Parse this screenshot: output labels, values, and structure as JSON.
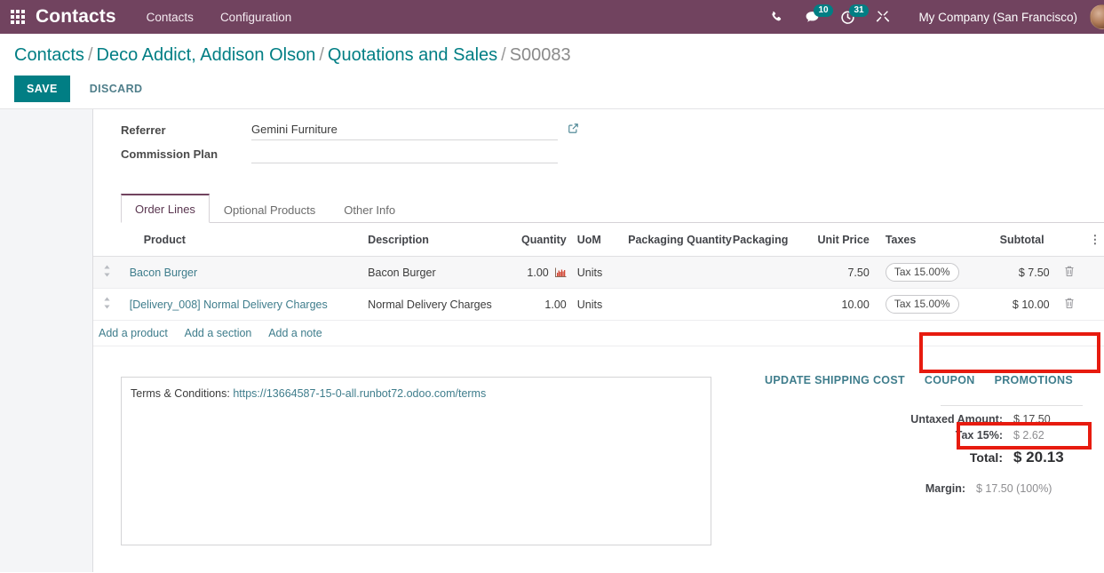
{
  "navbar": {
    "apps_icon": "apps-grid-icon",
    "brand": "Contacts",
    "menu": [
      {
        "label": "Contacts"
      },
      {
        "label": "Configuration"
      }
    ],
    "systray": {
      "phone_icon": "phone-icon",
      "messages_icon": "chat-bubble-icon",
      "messages_count": "10",
      "activities_icon": "clock-activity-icon",
      "activities_count": "31",
      "tools_icon": "crossed-tools-icon",
      "company": "My Company (San Francisco)",
      "avatar": "user-avatar"
    }
  },
  "control_panel": {
    "breadcrumb": [
      {
        "label": "Contacts",
        "type": "link"
      },
      {
        "label": "Deco Addict, Addison Olson",
        "type": "link"
      },
      {
        "label": "Quotations and Sales",
        "type": "link"
      },
      {
        "label": "S00083",
        "type": "current"
      }
    ],
    "separator": "/",
    "save_label": "SAVE",
    "discard_label": "DISCARD"
  },
  "form": {
    "fields": [
      {
        "label": "Referrer",
        "value": "Gemini Furniture",
        "has_dropdown": true,
        "has_external_link": true
      },
      {
        "label": "Commission Plan",
        "value": "",
        "has_dropdown": true,
        "has_external_link": false
      }
    ],
    "external_link_icon": "external-link-icon",
    "dropdown_icon": "chevron-down-icon"
  },
  "tabs": [
    {
      "label": "Order Lines",
      "active": true
    },
    {
      "label": "Optional Products",
      "active": false
    },
    {
      "label": "Other Info",
      "active": false
    }
  ],
  "order_lines": {
    "columns": [
      "Product",
      "Description",
      "Quantity",
      "UoM",
      "Packaging Quantity",
      "Packaging",
      "Unit Price",
      "Taxes",
      "Subtotal"
    ],
    "options_icon": "column-options-icon",
    "drag_handle_icon": "drag-handle-icon",
    "delete_icon": "trash-icon",
    "forecast_icon": "forecast-chart-icon",
    "rows": [
      {
        "product": "Bacon Burger",
        "description": "Bacon Burger",
        "quantity": "1.00",
        "has_forecast": true,
        "uom": "Units",
        "packaging_quantity": "",
        "packaging": "",
        "unit_price": "7.50",
        "taxes": "Tax 15.00%",
        "subtotal": "$ 7.50"
      },
      {
        "product": "[Delivery_008] Normal Delivery Charges",
        "description": "Normal Delivery Charges",
        "quantity": "1.00",
        "has_forecast": false,
        "uom": "Units",
        "packaging_quantity": "",
        "packaging": "",
        "unit_price": "10.00",
        "taxes": "Tax 15.00%",
        "subtotal": "$ 10.00"
      }
    ],
    "add_links": [
      {
        "label": "Add a product"
      },
      {
        "label": "Add a section"
      },
      {
        "label": "Add a note"
      }
    ]
  },
  "notes": {
    "terms_prefix": "Terms & Conditions: ",
    "terms_url": "https://13664587-15-0-all.runbot72.odoo.com/terms"
  },
  "order_actions": [
    {
      "label": "UPDATE SHIPPING COST",
      "highlighted": false
    },
    {
      "label": "COUPON",
      "highlighted": true
    },
    {
      "label": "PROMOTIONS",
      "highlighted": true
    }
  ],
  "totals": {
    "untaxed_label": "Untaxed Amount:",
    "untaxed_value": "$ 17.50",
    "tax_label": "Tax 15%:",
    "tax_value": "$ 2.62",
    "total_label": "Total:",
    "total_value": "$ 20.13",
    "margin_label": "Margin:",
    "margin_value": "$ 17.50 (100%)"
  },
  "annotations": {
    "accent_color": "#e71b0f",
    "boxes": [
      {
        "target": "coupon-promotions-buttons"
      },
      {
        "target": "total-amount"
      }
    ]
  },
  "colors": {
    "navbar": "#71435f",
    "primary": "#017e84",
    "link": "#3f7d8c",
    "annotation": "#e71b0f"
  }
}
